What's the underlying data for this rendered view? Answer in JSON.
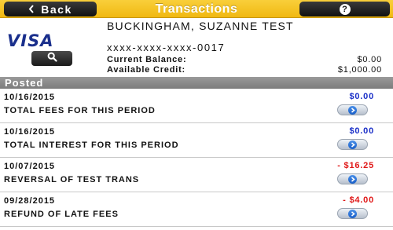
{
  "header": {
    "back_label": "Back",
    "back_icon": "chevron-left-icon",
    "title": "Transactions",
    "help_icon": "question-mark-icon",
    "help_glyph": "?",
    "bar_color": "#f2bd1a"
  },
  "account": {
    "card_brand": "VISA",
    "holder_name": "BUCKINGHAM, SUZANNE TEST",
    "masked_number": "xxxx-xxxx-xxxx-0017",
    "search_icon": "magnifier-icon",
    "current_balance_label": "Current Balance:",
    "current_balance_value": "$0.00",
    "available_credit_label": "Available Credit:",
    "available_credit_value": "$1,000.00"
  },
  "section": {
    "posted_label": "Posted"
  },
  "transactions": [
    {
      "date": "10/16/2015",
      "description": "TOTAL FEES FOR THIS PERIOD",
      "amount": "$0.00",
      "amount_color": "#1a2fc8"
    },
    {
      "date": "10/16/2015",
      "description": "TOTAL INTEREST FOR THIS PERIOD",
      "amount": "$0.00",
      "amount_color": "#1a2fc8"
    },
    {
      "date": "10/07/2015",
      "description": "REVERSAL OF TEST TRANS",
      "amount": "- $16.25",
      "amount_color": "#e01818"
    },
    {
      "date": "09/28/2015",
      "description": "REFUND OF LATE FEES",
      "amount": "- $4.00",
      "amount_color": "#e01818"
    }
  ],
  "colors": {
    "positive_amount": "#1a2fc8",
    "negative_amount": "#e01818",
    "posted_bar": "#8a8a8a"
  }
}
